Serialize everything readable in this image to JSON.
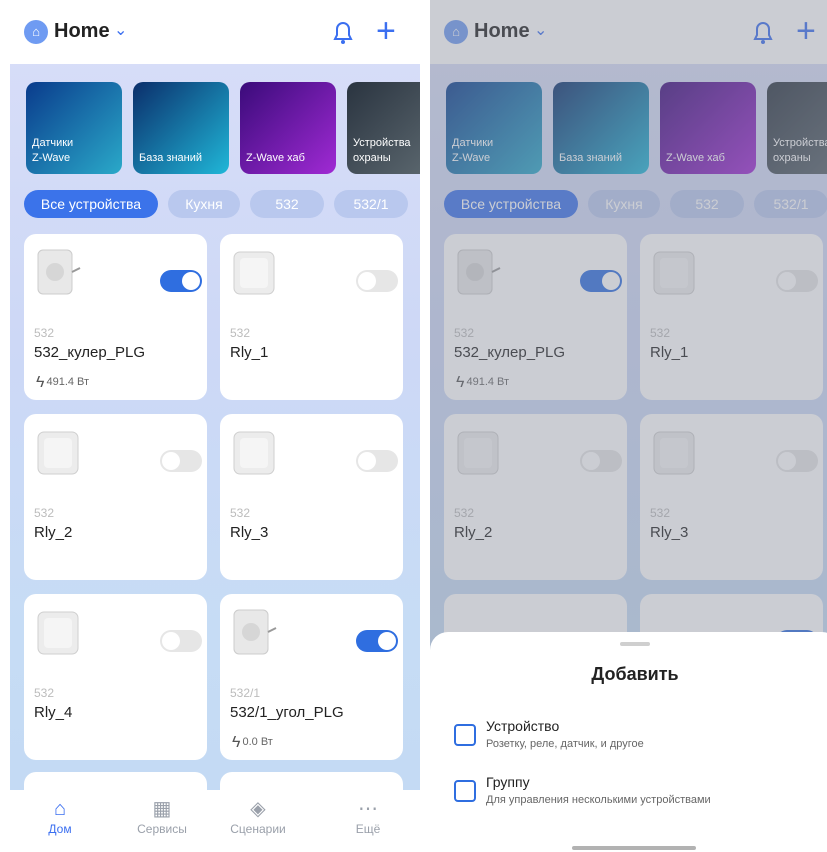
{
  "header": {
    "title": "Home"
  },
  "banners": [
    {
      "label": "Датчики\nZ-Wave"
    },
    {
      "label": "База знаний"
    },
    {
      "label": "Z-Wave хаб"
    },
    {
      "label": "Устройства\nохраны"
    }
  ],
  "chips": [
    "Все устройства",
    "Кухня",
    "532",
    "532/1"
  ],
  "devices": [
    {
      "room": "532",
      "name": "532_кулер_PLG",
      "power": "491.4 Вт",
      "on": true,
      "type": "plug"
    },
    {
      "room": "532",
      "name": "Rly_1",
      "on": false,
      "type": "relay"
    },
    {
      "room": "532",
      "name": "Rly_2",
      "on": false,
      "type": "relay"
    },
    {
      "room": "532",
      "name": "Rly_3",
      "on": false,
      "type": "relay"
    },
    {
      "room": "532",
      "name": "Rly_4",
      "on": false,
      "type": "relay"
    },
    {
      "room": "532/1",
      "name": "532/1_угол_PLG",
      "power": "0.0 Вт",
      "on": true,
      "type": "plug"
    }
  ],
  "tabbar": [
    {
      "label": "Дом",
      "icon": "home-icon"
    },
    {
      "label": "Сервисы",
      "icon": "grid-icon"
    },
    {
      "label": "Сценарии",
      "icon": "layers-icon"
    },
    {
      "label": "Ещё",
      "icon": "more-icon"
    }
  ],
  "sheet": {
    "title": "Добавить",
    "options": [
      {
        "title": "Устройство",
        "subtitle": "Розетку, реле, датчик, и другое"
      },
      {
        "title": "Группу",
        "subtitle": "Для управления несколькими устройствами"
      }
    ]
  },
  "colors": {
    "accent": "#3b6ff0",
    "chip_inactive": "#b9c8ee"
  }
}
